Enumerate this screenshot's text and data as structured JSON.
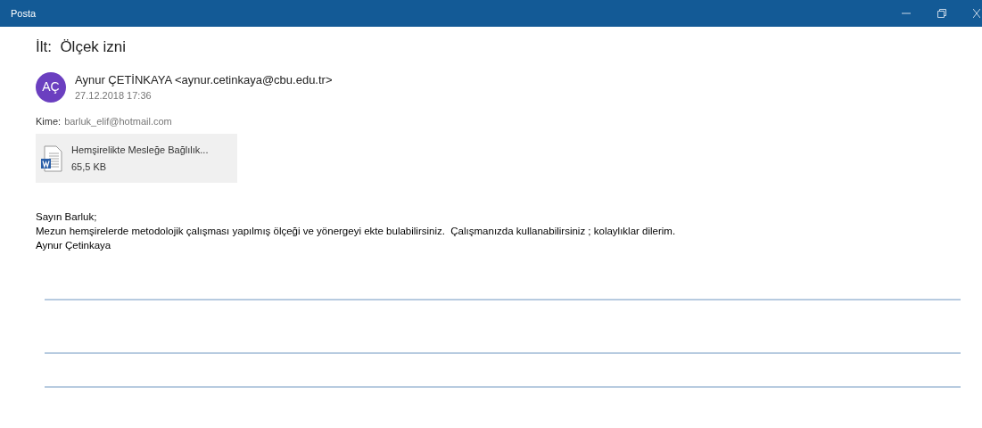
{
  "window": {
    "title": "Posta"
  },
  "subject": "İlt:  Ölçek izni",
  "sender": {
    "initials": "AÇ",
    "name": "Aynur ÇETİNKAYA <aynur.cetinkaya@cbu.edu.tr>",
    "date": "27.12.2018 17:36"
  },
  "to": {
    "label": "Kime:",
    "address": "barluk_elif@hotmail.com"
  },
  "attachment": {
    "name": "Hemşirelikte Mesleğe Bağlılık...",
    "size": "65,5 KB"
  },
  "body": [
    "Sayın Barluk;",
    "Mezun hemşirelerde metodolojik çalışması yapılmış ölçeği ve yönergeyi ekte bulabilirsiniz.  Çalışmanızda kullanabilirsiniz ; kolaylıklar dilerim.",
    "Aynur Çetinkaya"
  ]
}
